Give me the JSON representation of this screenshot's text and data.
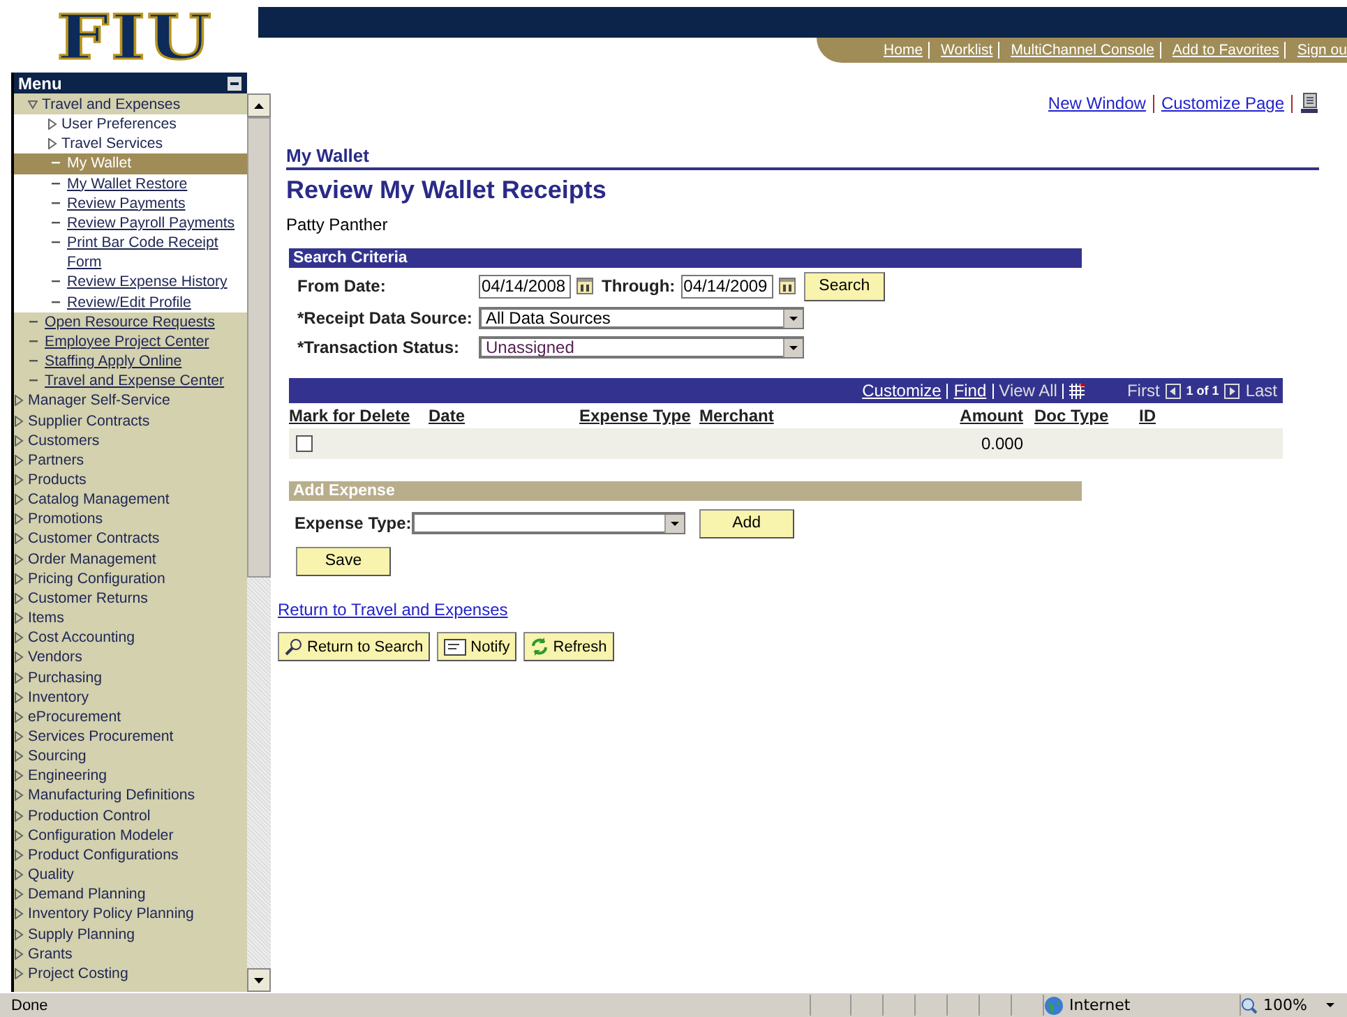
{
  "header": {
    "logo": "FIU",
    "links": [
      "Home",
      "Worklist",
      "MultiChannel Console",
      "Add to Favorites",
      "Sign ou"
    ]
  },
  "menu": {
    "title": "Menu",
    "items": [
      {
        "label": "Travel and Expenses",
        "kind": "folder",
        "expanded": true,
        "children": [
          {
            "label": "User Preferences",
            "kind": "folder",
            "expanded": false
          },
          {
            "label": "Travel Services",
            "kind": "folder",
            "expanded": false
          },
          {
            "label": "My Wallet",
            "kind": "link",
            "selected": true
          },
          {
            "label": "My Wallet Restore",
            "kind": "link",
            "selected": false
          },
          {
            "label": "Review Payments",
            "kind": "link",
            "selected": false
          },
          {
            "label": "Review Payroll Payments",
            "kind": "link",
            "selected": false
          },
          {
            "label": "Print Bar Code Receipt Form",
            "kind": "link",
            "selected": false
          },
          {
            "label": "Review Expense History",
            "kind": "link",
            "selected": false
          },
          {
            "label": "Review/Edit Profile",
            "kind": "link",
            "selected": false
          }
        ]
      },
      {
        "label": "Open Resource Requests",
        "kind": "link",
        "selected": false
      },
      {
        "label": "Employee Project Center",
        "kind": "link",
        "selected": false
      },
      {
        "label": "Staffing Apply Online",
        "kind": "link",
        "selected": false
      },
      {
        "label": "Travel and Expense Center",
        "kind": "link",
        "selected": false
      },
      {
        "label": "Manager Self-Service",
        "kind": "folder",
        "expanded": false
      },
      {
        "label": "Supplier Contracts",
        "kind": "folder",
        "expanded": false
      },
      {
        "label": "Customers",
        "kind": "folder",
        "expanded": false
      },
      {
        "label": "Partners",
        "kind": "folder",
        "expanded": false
      },
      {
        "label": "Products",
        "kind": "folder",
        "expanded": false
      },
      {
        "label": "Catalog Management",
        "kind": "folder",
        "expanded": false
      },
      {
        "label": "Promotions",
        "kind": "folder",
        "expanded": false
      },
      {
        "label": "Customer Contracts",
        "kind": "folder",
        "expanded": false
      },
      {
        "label": "Order Management",
        "kind": "folder",
        "expanded": false
      },
      {
        "label": "Pricing Configuration",
        "kind": "folder",
        "expanded": false
      },
      {
        "label": "Customer Returns",
        "kind": "folder",
        "expanded": false
      },
      {
        "label": "Items",
        "kind": "folder",
        "expanded": false
      },
      {
        "label": "Cost Accounting",
        "kind": "folder",
        "expanded": false
      },
      {
        "label": "Vendors",
        "kind": "folder",
        "expanded": false
      },
      {
        "label": "Purchasing",
        "kind": "folder",
        "expanded": false
      },
      {
        "label": "Inventory",
        "kind": "folder",
        "expanded": false
      },
      {
        "label": "eProcurement",
        "kind": "folder",
        "expanded": false
      },
      {
        "label": "Services Procurement",
        "kind": "folder",
        "expanded": false
      },
      {
        "label": "Sourcing",
        "kind": "folder",
        "expanded": false
      },
      {
        "label": "Engineering",
        "kind": "folder",
        "expanded": false
      },
      {
        "label": "Manufacturing Definitions",
        "kind": "folder",
        "expanded": false
      },
      {
        "label": "Production Control",
        "kind": "folder",
        "expanded": false
      },
      {
        "label": "Configuration Modeler",
        "kind": "folder",
        "expanded": false
      },
      {
        "label": "Product Configurations",
        "kind": "folder",
        "expanded": false
      },
      {
        "label": "Quality",
        "kind": "folder",
        "expanded": false
      },
      {
        "label": "Demand Planning",
        "kind": "folder",
        "expanded": false
      },
      {
        "label": "Inventory Policy Planning",
        "kind": "folder",
        "expanded": false
      },
      {
        "label": "Supply Planning",
        "kind": "folder",
        "expanded": false
      },
      {
        "label": "Grants",
        "kind": "folder",
        "expanded": false
      },
      {
        "label": "Project Costing",
        "kind": "folder",
        "expanded": false
      }
    ]
  },
  "page_links": [
    "New Window",
    "Customize Page"
  ],
  "breadcrumb": "My Wallet",
  "title": "Review My Wallet Receipts",
  "user": "Patty Panther",
  "search": {
    "title": "Search Criteria",
    "from_label": "From Date:",
    "from_value": "04/14/2008",
    "through_label": "Through:",
    "through_value": "04/14/2009",
    "button": "Search",
    "source_label": "*Receipt Data Source:",
    "source_value": "All Data Sources",
    "status_label": "*Transaction Status:",
    "status_value": "Unassigned"
  },
  "grid": {
    "tools": [
      {
        "label": "Customize",
        "kind": "link"
      },
      {
        "label": "Find",
        "kind": "link"
      },
      {
        "label": "View All",
        "kind": "text"
      }
    ],
    "nav": {
      "first": "First",
      "count": "1 of 1",
      "last": "Last"
    },
    "columns": [
      "Mark for Delete",
      "Date",
      "Expense Type",
      "Merchant",
      "Amount",
      "Doc Type",
      "ID"
    ],
    "rows": [
      {
        "checked": false,
        "amount": "0.000"
      }
    ]
  },
  "add_expense": {
    "title": "Add Expense",
    "label": "Expense Type:",
    "button": "Add",
    "save": "Save"
  },
  "return_link": "Return to Travel and Expenses",
  "bottom_buttons": [
    {
      "label": "Return to Search",
      "kind": "search"
    },
    {
      "label": "Notify",
      "kind": "notify"
    },
    {
      "label": "Refresh",
      "kind": "refresh"
    }
  ],
  "status_bar": {
    "text": "Done",
    "zone": "Internet",
    "zoom": "100%"
  }
}
